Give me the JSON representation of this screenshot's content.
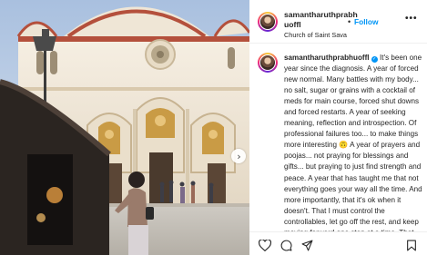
{
  "post": {
    "username": "samantharuthprabhuoffl",
    "follow_label": "Follow",
    "separator": "•",
    "location": "Church of Saint Sava",
    "more_label": "•••",
    "carousel_next": "›"
  },
  "caption": {
    "username": "samantharuthprabhuoffl",
    "verified_glyph": "✓",
    "text": "It's been one year since the diagnosis. A year of forced new normal. Many battles with my body... no salt, sugar or grains with a cocktail of meds for main course, forced shut downs and forced restarts. A year of seeking meaning, reflection and introspection. Of professional failures too... to make things more interesting 🙃 A year of prayers and poojas... not praying for blessings and gifts... but praying to just find strength and peace. A year that has taught me that not everything goes your way all the time. And more importantly, that it's ok when it doesn't. That I must control the controllables, let go off the rest, and keep moving forward one step at a time. That sometimes it's not"
  },
  "icons": {
    "like": "heart-icon",
    "comment": "comment-icon",
    "share": "share-icon",
    "save": "bookmark-icon",
    "more": "more-options-icon",
    "next": "chevron-right-icon"
  },
  "colors": {
    "follow": "#0095f6",
    "verified": "#0095f6",
    "text": "#262626",
    "divider": "#efefef",
    "sky": "#c9d7ea",
    "church_wall": "#f1e9dc",
    "church_trim": "#b4503c"
  }
}
